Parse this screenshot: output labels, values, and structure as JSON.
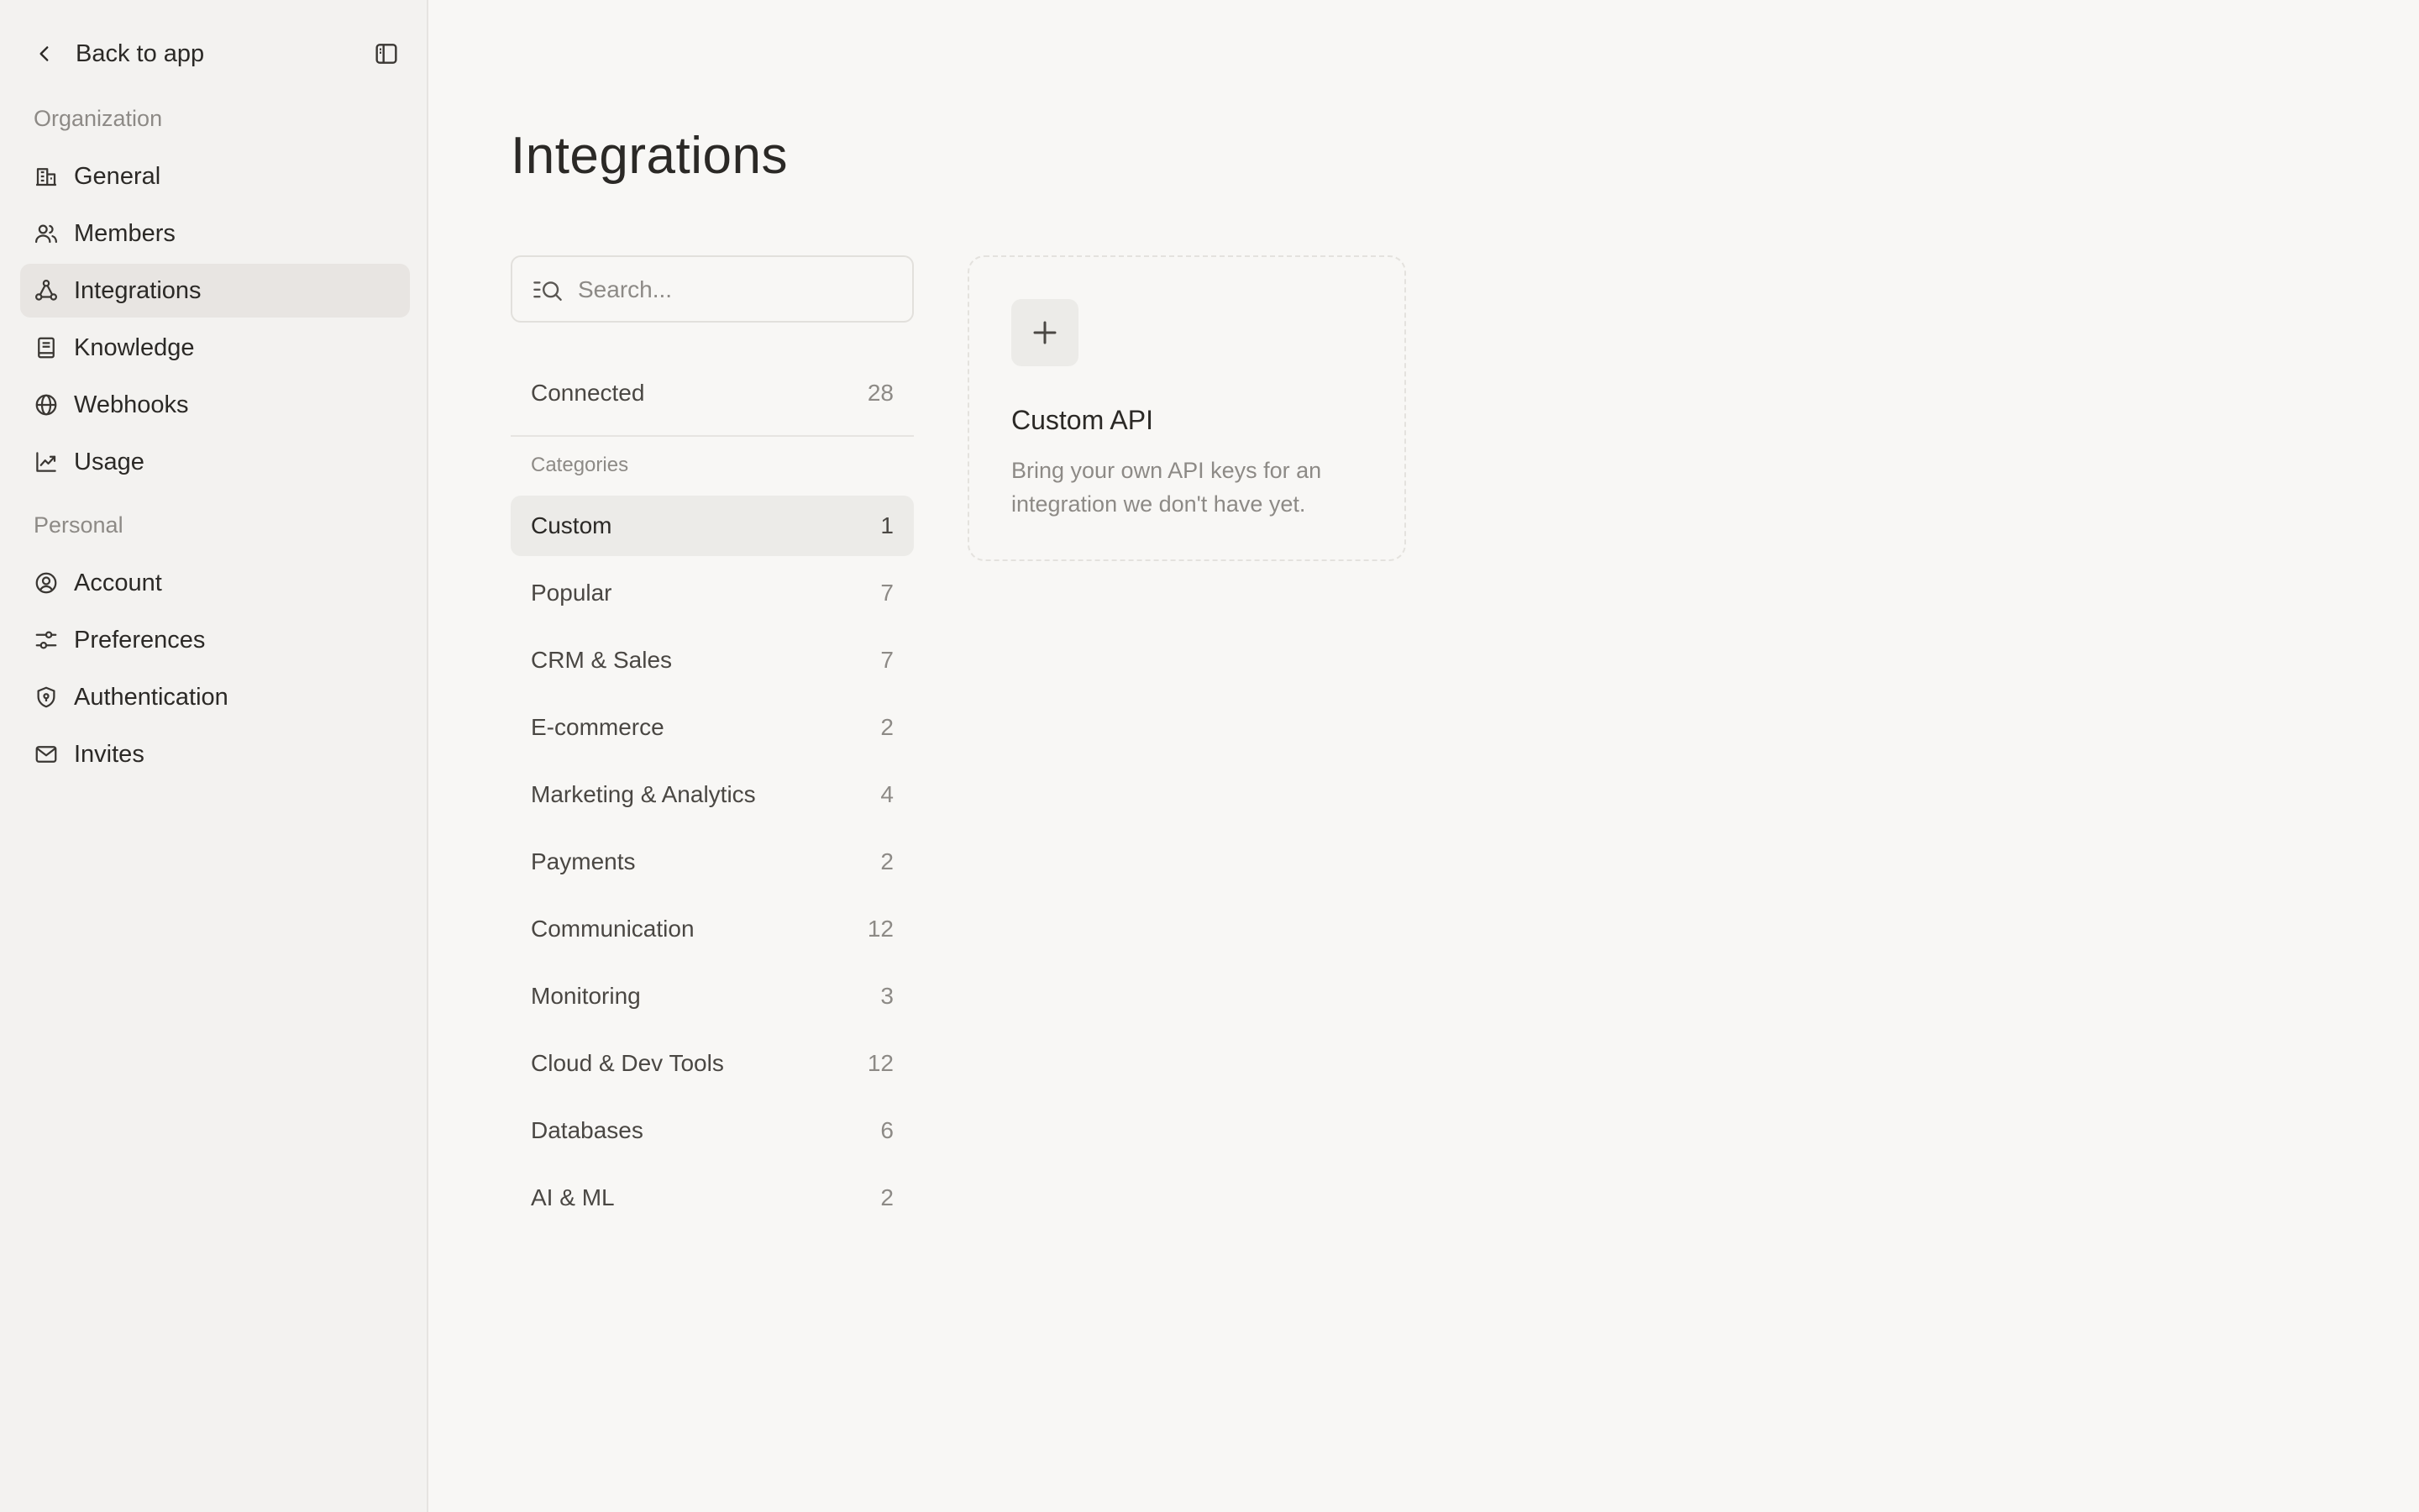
{
  "sidebar": {
    "back_label": "Back to app",
    "organization_label": "Organization",
    "personal_label": "Personal",
    "organization_items": [
      {
        "label": "General",
        "icon": "building-icon"
      },
      {
        "label": "Members",
        "icon": "users-icon"
      },
      {
        "label": "Integrations",
        "icon": "integrations-icon",
        "active": true
      },
      {
        "label": "Knowledge",
        "icon": "book-icon"
      },
      {
        "label": "Webhooks",
        "icon": "globe-icon"
      },
      {
        "label": "Usage",
        "icon": "chart-line-icon"
      }
    ],
    "personal_items": [
      {
        "label": "Account",
        "icon": "user-circle-icon"
      },
      {
        "label": "Preferences",
        "icon": "sliders-icon"
      },
      {
        "label": "Authentication",
        "icon": "shield-icon"
      },
      {
        "label": "Invites",
        "icon": "mail-icon"
      }
    ]
  },
  "main": {
    "title": "Integrations",
    "search": {
      "placeholder": "Search...",
      "value": ""
    },
    "connected": {
      "label": "Connected",
      "count": "28"
    },
    "categories_heading": "Categories",
    "categories": [
      {
        "label": "Custom",
        "count": "1",
        "active": true
      },
      {
        "label": "Popular",
        "count": "7"
      },
      {
        "label": "CRM & Sales",
        "count": "7"
      },
      {
        "label": "E-commerce",
        "count": "2"
      },
      {
        "label": "Marketing & Analytics",
        "count": "4"
      },
      {
        "label": "Payments",
        "count": "2"
      },
      {
        "label": "Communication",
        "count": "12"
      },
      {
        "label": "Monitoring",
        "count": "3"
      },
      {
        "label": "Cloud & Dev Tools",
        "count": "12"
      },
      {
        "label": "Databases",
        "count": "6"
      },
      {
        "label": "AI & ML",
        "count": "2"
      }
    ],
    "card": {
      "title": "Custom API",
      "description": "Bring your own API keys for an integration we don't have yet.",
      "icon": "plus-icon"
    }
  },
  "colors": {
    "background": "#f8f7f5",
    "sidebar_background": "#f3f2f0",
    "active_item": "#e8e5e2",
    "text_primary": "#2b2926",
    "text_muted": "#8d8a86"
  }
}
